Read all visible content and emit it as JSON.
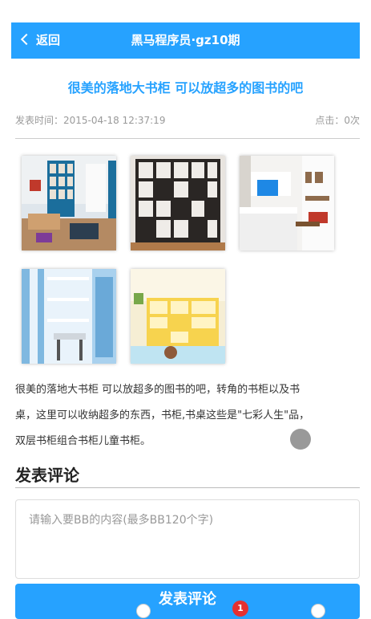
{
  "header": {
    "back_label": "返回",
    "title": "黑马程序员·gz10期"
  },
  "article": {
    "title": "很美的落地大书柜 可以放超多的图书的吧",
    "publish_time": "发表时间：2015-04-18 12:37:19",
    "clicks": "点击：0次",
    "content_lines": [
      "很美的落地大书柜 可以放超多的图书的吧，转角的书柜以及书",
      "桌，这里可以收纳超多的东西，书柜,书桌这些是\"七彩人生\"品，",
      "双层书柜组合书柜儿童书柜。"
    ]
  },
  "comments": {
    "section_title": "发表评论",
    "placeholder": "请输入要BB的内容(最多BB120个字)",
    "submit_label": "发表评论"
  },
  "tabbar": {
    "cart_badge": "1"
  }
}
